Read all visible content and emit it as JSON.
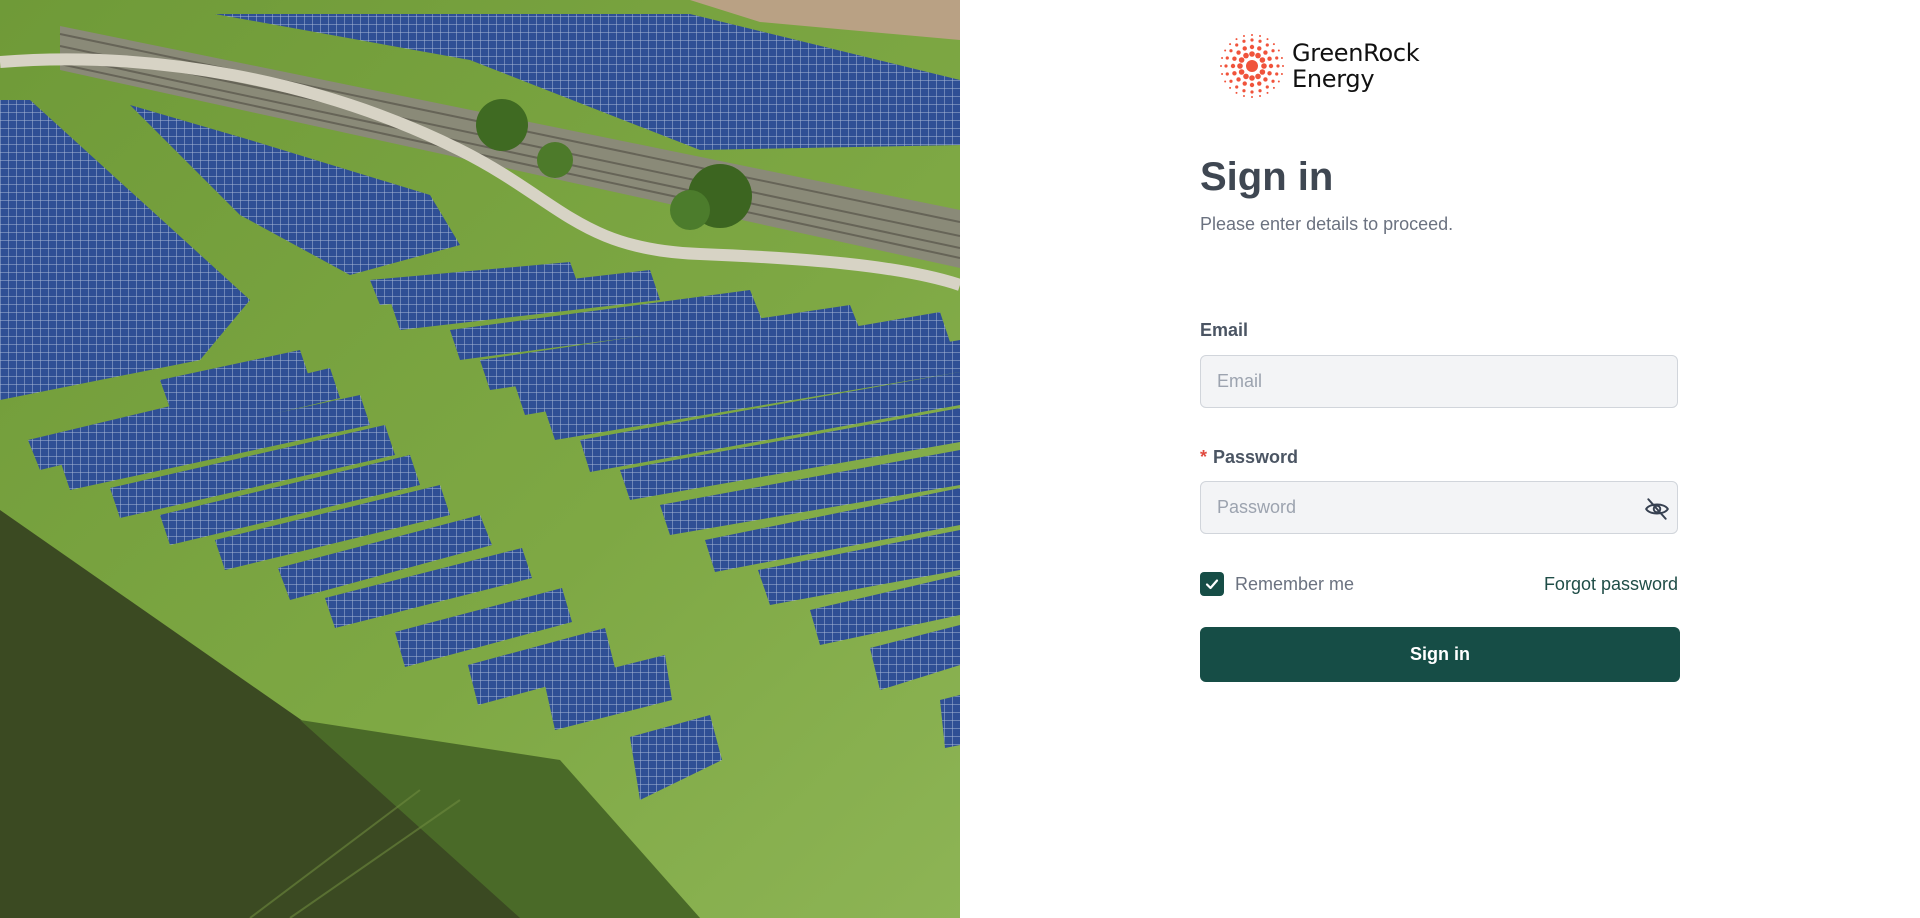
{
  "brand": {
    "name_line1": "GreenRock",
    "name_line2": "Energy",
    "logo_icon": "sunburst-dots-icon",
    "logo_color": "#f0533b"
  },
  "hero": {
    "image": "aerial-solar-farm-photo"
  },
  "form": {
    "title": "Sign in",
    "subtitle": "Please enter details to proceed.",
    "email_label": "Email",
    "email_placeholder": "Email",
    "email_value": "",
    "password_required_mark": "*",
    "password_label": "Password",
    "password_placeholder": "Password",
    "password_value": "",
    "password_toggle_icon": "eye-off-icon",
    "remember_label": "Remember me",
    "remember_checked": true,
    "forgot_label": "Forgot password",
    "submit_label": "Sign in"
  },
  "colors": {
    "primary": "#164d46",
    "required": "#e04a3f",
    "title": "#3f4752",
    "muted": "#6b7280"
  }
}
